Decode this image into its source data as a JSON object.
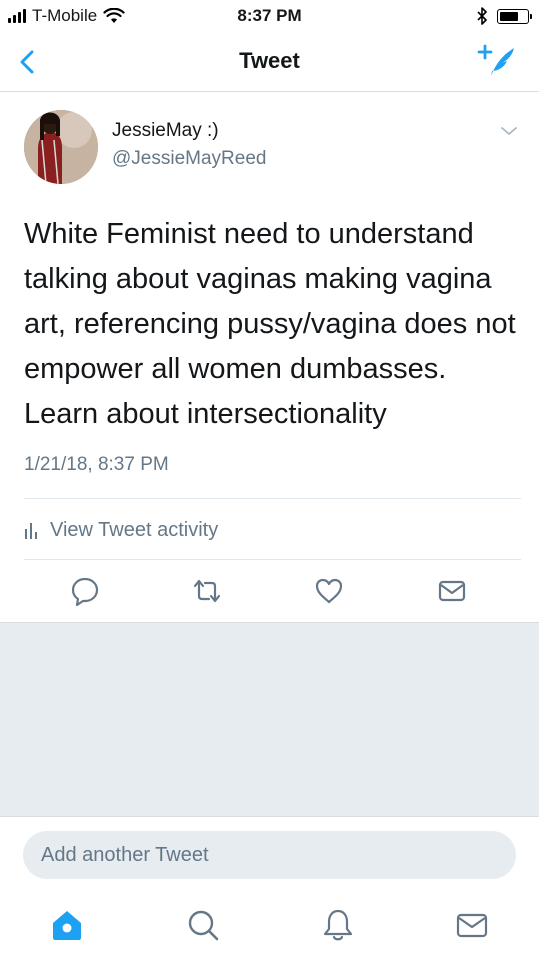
{
  "status": {
    "carrier": "T-Mobile",
    "time": "8:37 PM"
  },
  "nav": {
    "title": "Tweet"
  },
  "tweet": {
    "display_name": "JessieMay :)",
    "handle": "@JessieMayReed",
    "text": "White Feminist need to understand talking about vaginas making vagina art, referencing pussy/vagina does not empower all women dumbasses. Learn about intersectionality",
    "timestamp": "1/21/18, 8:37 PM",
    "activity_label": "View Tweet activity"
  },
  "composer": {
    "placeholder": "Add another Tweet"
  },
  "tabs": [
    "home-icon",
    "search-icon",
    "notifications-icon",
    "messages-icon"
  ],
  "colors": {
    "accent": "#1da1f2",
    "secondary_text": "#657786",
    "background_gray": "#e6ecf0"
  }
}
